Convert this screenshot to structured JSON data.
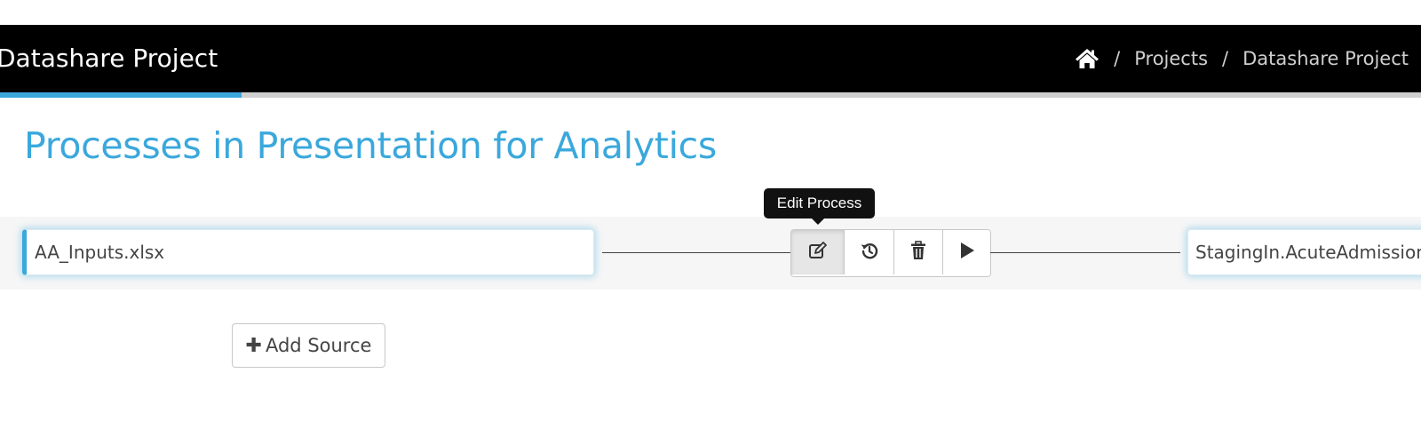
{
  "header": {
    "app_title": "Datashare Project",
    "breadcrumb": {
      "home_icon": "home-icon",
      "separator": "/",
      "items": [
        {
          "label": "Projects"
        },
        {
          "label": "Datashare Project"
        }
      ]
    },
    "progress_fraction": 0.17
  },
  "main": {
    "heading": "Processes in Presentation for Analytics",
    "process": {
      "source": "AA_Inputs.xlsx",
      "target": "StagingIn.AcuteAdmissions",
      "actions": [
        {
          "name": "edit",
          "icon": "edit-icon",
          "active": true
        },
        {
          "name": "history",
          "icon": "history-icon"
        },
        {
          "name": "delete",
          "icon": "trash-icon"
        },
        {
          "name": "run",
          "icon": "play-icon"
        }
      ],
      "tooltip": "Edit Process"
    },
    "add_source_label": "Add Source",
    "add_source_icon": "plus-icon"
  },
  "colors": {
    "accent": "#3aa8dc",
    "topbar": "#000000",
    "tooltip": "#111111"
  }
}
